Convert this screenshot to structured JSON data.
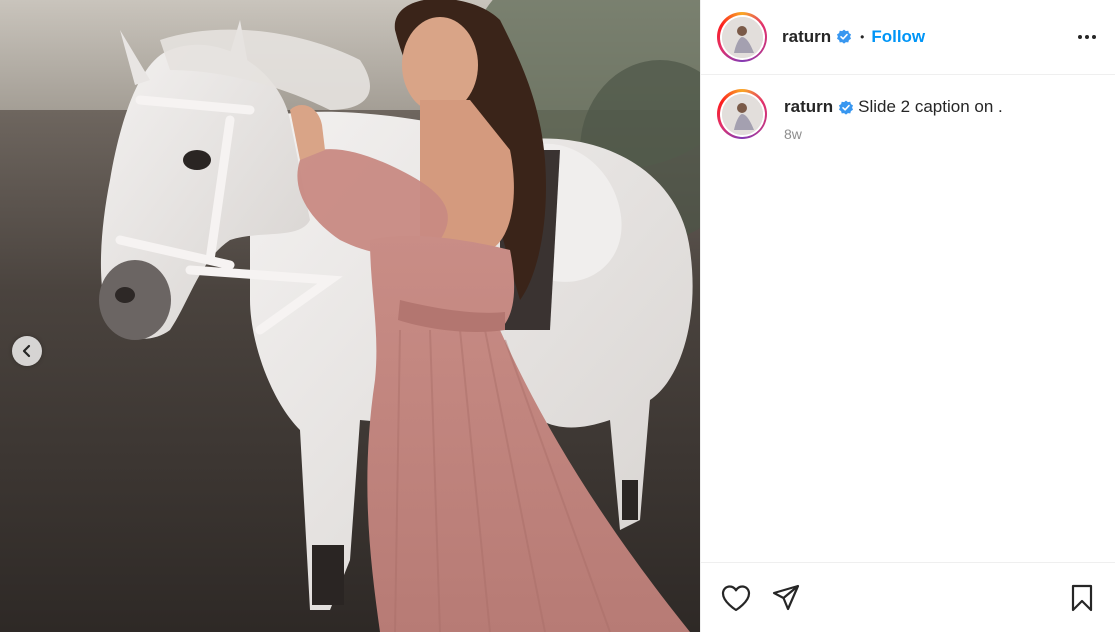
{
  "post": {
    "username": "raturn",
    "verified": true,
    "separator": "•",
    "follow_label": "Follow",
    "caption_text": "Slide 2 caption on .",
    "time_ago": "8w"
  },
  "media": {
    "description_icon": "photo-of-woman-in-pink-dress-with-white-horse",
    "carousel_prev_icon": "chevron-left-icon"
  },
  "actions": {
    "like_icon": "heart-icon",
    "share_icon": "paper-plane-icon",
    "save_icon": "bookmark-icon",
    "more_icon": "more-options-icon"
  },
  "colors": {
    "follow": "#0095f6",
    "verified": "#3897f0",
    "text": "#262626",
    "muted": "#8e8e8e"
  }
}
